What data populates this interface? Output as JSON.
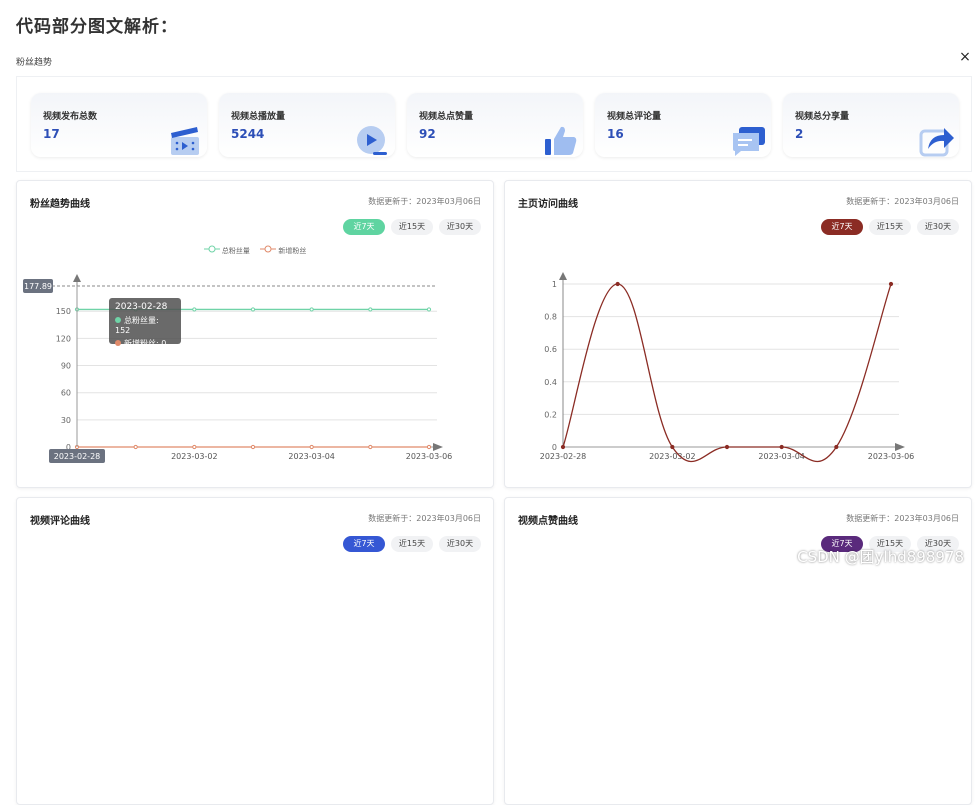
{
  "heading": "代码部分图文解析：",
  "dialog": {
    "title": "粉丝趋势",
    "close": "×"
  },
  "stats": [
    {
      "label": "视频发布总数",
      "value": "17",
      "icon": "video-clapper-icon"
    },
    {
      "label": "视频总播放量",
      "value": "5244",
      "icon": "play-icon"
    },
    {
      "label": "视频总点赞量",
      "value": "92",
      "icon": "thumbs-up-icon"
    },
    {
      "label": "视频总评论量",
      "value": "16",
      "icon": "comment-icon"
    },
    {
      "label": "视频总分享量",
      "value": "2",
      "icon": "share-icon"
    }
  ],
  "ranges": [
    "近7天",
    "近15天",
    "近30天"
  ],
  "cards": {
    "fans": {
      "title": "粉丝趋势曲线",
      "updated": "数据更新于：2023年03月06日",
      "active_color": "#5fd4a1",
      "legend": [
        "总粉丝量",
        "新增粉丝"
      ]
    },
    "visits": {
      "title": "主页访问曲线",
      "updated": "数据更新于：2023年03月06日",
      "active_color": "#8b2c24"
    },
    "comments": {
      "title": "视频评论曲线",
      "updated": "数据更新于：2023年03月06日",
      "active_color": "#3557d4"
    },
    "likes": {
      "title": "视频点赞曲线",
      "updated": "数据更新于：2023年03月06日",
      "active_color": "#5a2a7c"
    }
  },
  "tooltip": {
    "date": "2023-02-28",
    "total_label": "总粉丝量: 152",
    "new_label": "新增粉丝: 0"
  },
  "chart_data": [
    {
      "type": "line",
      "title": "粉丝趋势曲线",
      "x": [
        "2023-02-28",
        "2023-03-01",
        "2023-03-02",
        "2023-03-03",
        "2023-03-04",
        "2023-03-05",
        "2023-03-06"
      ],
      "x_tick_labels": [
        "2023-02-28",
        "2023-03-02",
        "2023-03-04",
        "2023-03-06"
      ],
      "y_ticks": [
        0,
        30,
        60,
        90,
        120,
        150
      ],
      "ylim": [
        0,
        177.89
      ],
      "axis_pointer_label": "177.89",
      "series": [
        {
          "name": "总粉丝量",
          "color": "#6fd3a7",
          "values": [
            152,
            152,
            152,
            152,
            152,
            152,
            152
          ]
        },
        {
          "name": "新增粉丝",
          "color": "#e08a6a",
          "values": [
            0,
            0,
            0,
            0,
            0,
            0,
            0
          ]
        }
      ],
      "legend": "top-center",
      "grid": true
    },
    {
      "type": "line",
      "title": "主页访问曲线",
      "x": [
        "2023-02-28",
        "2023-03-01",
        "2023-03-02",
        "2023-03-03",
        "2023-03-04",
        "2023-03-05",
        "2023-03-06"
      ],
      "x_tick_labels": [
        "2023-02-28",
        "2023-03-02",
        "2023-03-04",
        "2023-03-06"
      ],
      "y_ticks": [
        0,
        0.2,
        0.4,
        0.6,
        0.8,
        1
      ],
      "ylim": [
        0,
        1
      ],
      "series": [
        {
          "color": "#8b2c24",
          "values": [
            0,
            1,
            0,
            0,
            0,
            0,
            1
          ]
        }
      ],
      "grid": true
    }
  ],
  "watermark": "CSDN @团ylhd898978"
}
